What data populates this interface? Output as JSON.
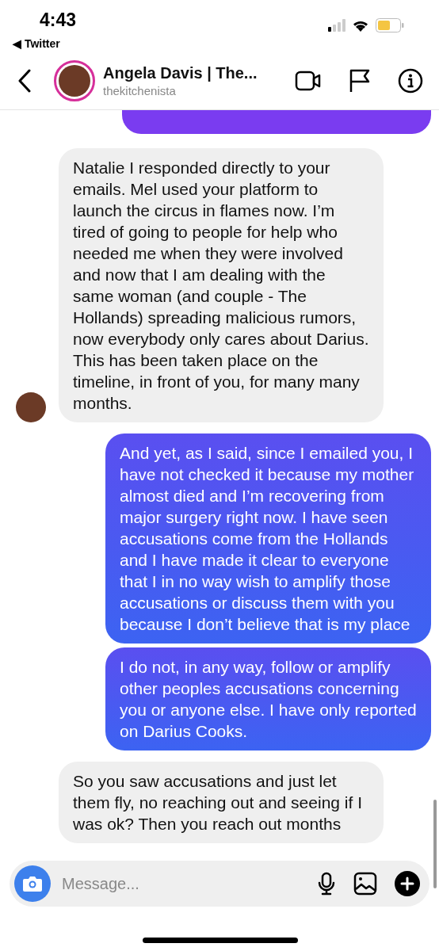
{
  "status_bar": {
    "time": "4:43",
    "back_app": "◀ Twitter"
  },
  "header": {
    "name": "Angela Davis | The...",
    "username": "thekitchenista"
  },
  "messages": [
    {
      "kind": "incoming",
      "text": "Natalie I responded directly to your emails. Mel used your platform to launch the circus in flames now. I’m tired of going to people for help who needed me when they were involved and now that I am dealing with the same woman (and couple - The Hollands) spreading malicious rumors, now everybody only cares about Darius. This has been taken place on the timeline, in front of you, for many many months.",
      "avatar": true
    },
    {
      "kind": "outgoing",
      "text": "And yet, as I said, since I emailed you, I have not checked it because my mother almost died and I’m recovering from major surgery right now. I have seen accusations come from the Hollands and I have made it clear to everyone that I in no way wish to amplify those accusations or discuss them with you because I don’t believe that is my place",
      "avatar": false
    },
    {
      "kind": "outgoing",
      "text": "I do not, in any way, follow or amplify other peoples accusations concerning you or anyone else. I have only reported on Darius Cooks.",
      "avatar": false
    },
    {
      "kind": "incoming",
      "text": "So you saw accusations and just let them fly, no reaching out and seeing if I was ok? Then you reach out months",
      "avatar": false
    }
  ],
  "composer": {
    "placeholder": "Message..."
  }
}
